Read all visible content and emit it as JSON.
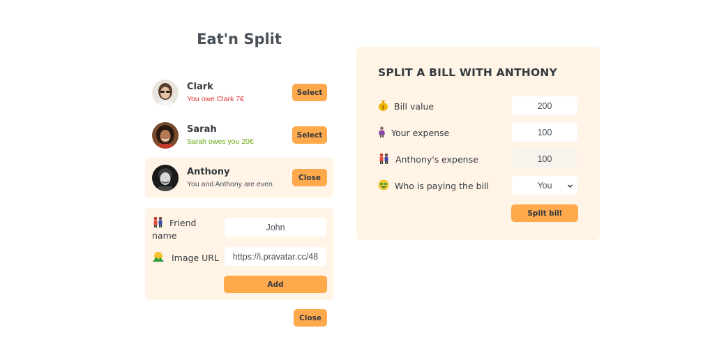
{
  "app": {
    "title": "Eat'n Split"
  },
  "friends": [
    {
      "name": "Clark",
      "balance_text": "You owe Clark 7€",
      "balance_type": "negative",
      "button": "Select",
      "selected": false
    },
    {
      "name": "Sarah",
      "balance_text": "Sarah owes you 20€",
      "balance_type": "positive",
      "button": "Select",
      "selected": false
    },
    {
      "name": "Anthony",
      "balance_text": "You and Anthony are even",
      "balance_type": "even",
      "button": "Close",
      "selected": true
    }
  ],
  "add_form": {
    "name_label": "Friend name",
    "name_value": "John",
    "image_label": "Image URL",
    "image_value": "https://i.pravatar.cc/48",
    "add_button": "Add"
  },
  "close_button": "Close",
  "split": {
    "heading": "SPLIT A BILL WITH ANTHONY",
    "bill_label": "Bill value",
    "bill_value": "200",
    "your_expense_label": "Your expense",
    "your_expense_value": "100",
    "friend_expense_label": "Anthony's expense",
    "friend_expense_value": "100",
    "payer_label": "Who is paying the bill",
    "payer_value": "You",
    "submit_button": "Split bill"
  },
  "colors": {
    "accent": "#ffa94d",
    "panel": "#fff4e6",
    "owe": "#e03131",
    "owed": "#66a80f"
  },
  "icons": [
    "money-bag-icon",
    "person-icon",
    "couple-icon",
    "money-face-icon",
    "image-icon",
    "chevron-down-icon"
  ]
}
